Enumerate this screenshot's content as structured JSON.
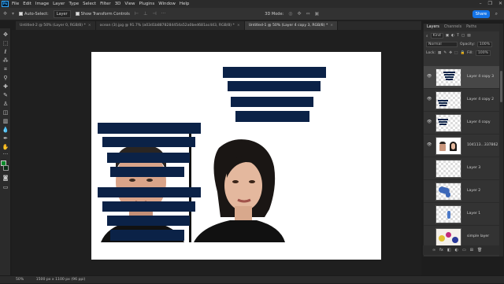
{
  "menu": [
    "File",
    "Edit",
    "Image",
    "Layer",
    "Type",
    "Select",
    "Filter",
    "3D",
    "View",
    "Plugins",
    "Window",
    "Help"
  ],
  "app_logo": "Ps",
  "window_controls": [
    "–",
    "❐",
    "✕"
  ],
  "options": {
    "auto_select_label": "Auto-Select:",
    "auto_select_value": "Layer",
    "transform_label": "Show Transform Controls",
    "mode_3d": "3D Mode:",
    "share_label": "Share"
  },
  "tabs": [
    {
      "label": "Untitled-2 @ 50% (Layer 0, RGB/8) *",
      "active": false
    },
    {
      "label": "ocean (3).jpg @ 91.7% (a03d1b8878284454a52a0bed681ac443, RGB/8) *",
      "active": false
    },
    {
      "label": "Untitled-1 @ 50% (Layer 4 copy 3, RGB/8) *",
      "active": true
    }
  ],
  "status": {
    "zoom": "50%",
    "doc_size": "1500 px x 1100 px (96 ppi)"
  },
  "panel": {
    "tabs": [
      "Layers",
      "Channels",
      "Paths"
    ],
    "kind_label": "Kind",
    "blend_mode": "Normal",
    "opacity_label": "Opacity:",
    "opacity_value": "100%",
    "lock_label": "Lock:",
    "fill_label": "Fill:",
    "fill_value": "100%"
  },
  "layers": [
    {
      "name": "Layer 4 copy 3",
      "visible": true,
      "selected": true
    },
    {
      "name": "Layer 4 copy 2",
      "visible": true,
      "selected": false
    },
    {
      "name": "Layer 4 copy",
      "visible": true,
      "selected": false
    },
    {
      "name": "104113...337862",
      "visible": true,
      "selected": false
    },
    {
      "name": "Layer 3",
      "visible": false,
      "selected": false
    },
    {
      "name": "Layer 2",
      "visible": false,
      "selected": false
    },
    {
      "name": "Layer 1",
      "visible": false,
      "selected": false
    },
    {
      "name": "simple layer",
      "visible": false,
      "selected": false
    }
  ],
  "colors": {
    "bar_navy": "#0b2247",
    "accent": "#1473e6",
    "foreground": "#0a8a2a"
  }
}
